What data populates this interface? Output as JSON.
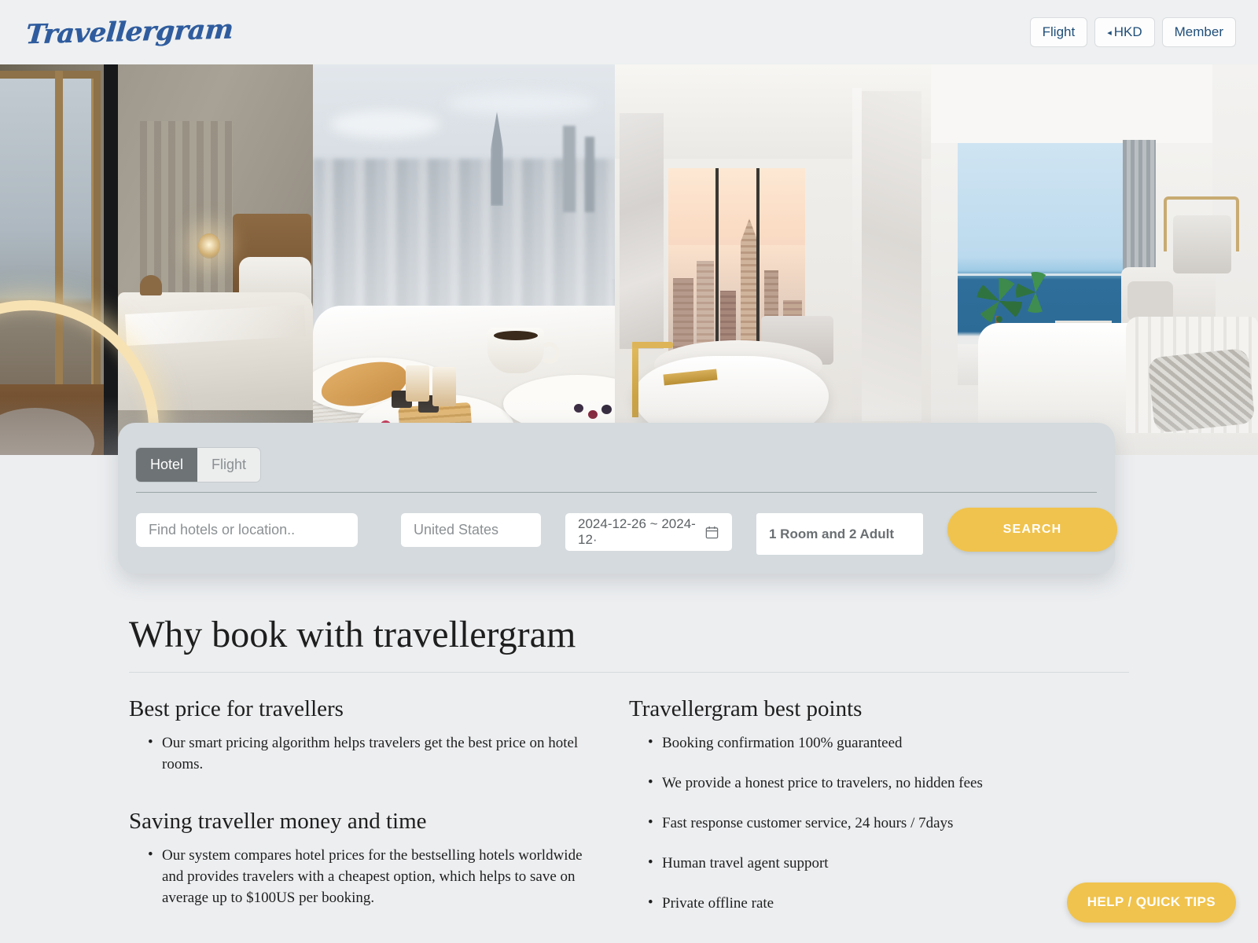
{
  "header": {
    "logo_text": "Travellergram",
    "buttons": [
      {
        "label": "Flight",
        "name": "flight-button"
      },
      {
        "label": "HKD",
        "caret": "◂",
        "name": "currency-button"
      },
      {
        "label": "Member",
        "name": "member-button"
      }
    ]
  },
  "hero": {
    "images": [
      {
        "alt": "hotel-bedroom-with-arc-lamp"
      },
      {
        "alt": "breakfast-in-bed-with-city-view"
      },
      {
        "alt": "marble-bathroom-with-skyline-view"
      },
      {
        "alt": "ocean-view-suite-living-room"
      }
    ]
  },
  "search": {
    "tabs": [
      {
        "label": "Hotel",
        "active": true
      },
      {
        "label": "Flight",
        "active": false
      }
    ],
    "location_placeholder": "Find hotels or location..",
    "location_value": "",
    "country_placeholder": "United States",
    "country_value": "",
    "dates_value": "2024-12-26 ~ 2024-12·",
    "rooms_value": "1 Room and 2 Adult",
    "search_label": "SEARCH",
    "accent_color": "#f0c34e",
    "panel_color": "#d4dadd"
  },
  "why": {
    "title": "Why book with travellergram",
    "left": {
      "sections": [
        {
          "heading": "Best price for travellers",
          "bullets": [
            "Our smart pricing algorithm helps travelers get the best price on hotel rooms."
          ]
        },
        {
          "heading": "Saving traveller money and time",
          "bullets": [
            "Our system compares hotel prices for the bestselling hotels worldwide and provides travelers with a cheapest option, which helps to save on average up to $100US per booking."
          ]
        }
      ]
    },
    "right": {
      "heading": "Travellergram best points",
      "bullets": [
        "Booking confirmation 100% guaranteed",
        "We provide a honest price to travelers, no hidden fees",
        "Fast response customer service, 24 hours / 7days",
        "Human travel agent support",
        "Private offline rate"
      ]
    }
  },
  "help": {
    "label": "HELP / QUICK TIPS"
  }
}
